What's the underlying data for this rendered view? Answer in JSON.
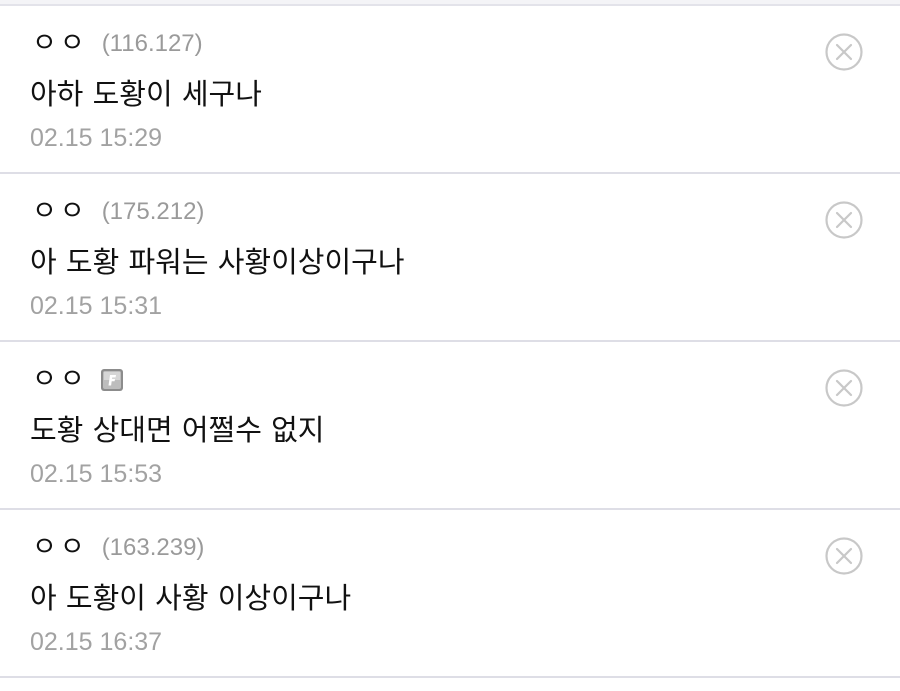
{
  "comments": [
    {
      "nickname": "ㅇㅇ",
      "ip": "(116.127)",
      "text": "아하 도황이 세구나",
      "time": "02.15 15:29",
      "badge": false
    },
    {
      "nickname": "ㅇㅇ",
      "ip": "(175.212)",
      "text": "아 도황 파워는 사황이상이구나",
      "time": "02.15 15:31",
      "badge": false
    },
    {
      "nickname": "ㅇㅇ",
      "ip": "",
      "text": "도황 상대면 어쩔수 없지",
      "time": "02.15 15:53",
      "badge": true,
      "badge_icon": "fixed-nick-icon"
    },
    {
      "nickname": "ㅇㅇ",
      "ip": "(163.239)",
      "text": "아 도황이 사황 이상이구나",
      "time": "02.15 16:37",
      "badge": false
    }
  ],
  "icons": {
    "delete": "close-circle-icon"
  },
  "colors": {
    "text": "#111111",
    "muted": "#9a9a9a",
    "divider": "#dedee6",
    "icon": "#c8c8c8"
  }
}
